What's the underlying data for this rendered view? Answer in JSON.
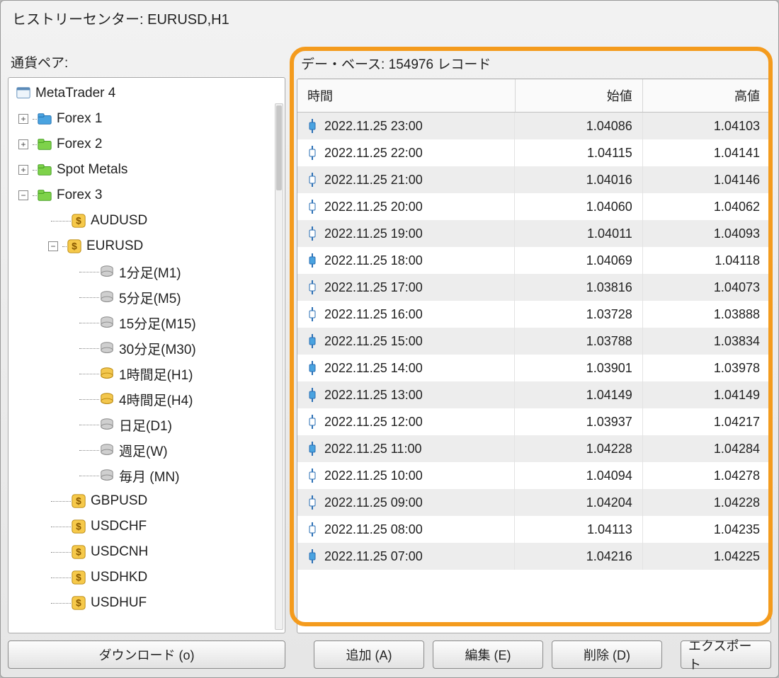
{
  "title": "ヒストリーセンター: EURUSD,H1",
  "left": {
    "label": "通貨ペア:",
    "root": "MetaTrader 4",
    "groups": [
      {
        "name": "Forex 1",
        "color": "blue",
        "expanded": false
      },
      {
        "name": "Forex 2",
        "color": "green",
        "expanded": false
      },
      {
        "name": "Spot Metals",
        "color": "green",
        "expanded": false
      },
      {
        "name": "Forex 3",
        "color": "green",
        "expanded": true
      }
    ],
    "symbols_before": [
      "AUDUSD"
    ],
    "selected_symbol": "EURUSD",
    "timeframes": [
      {
        "label": "1分足(M1)",
        "state": "grey"
      },
      {
        "label": "5分足(M5)",
        "state": "grey"
      },
      {
        "label": "15分足(M15)",
        "state": "grey"
      },
      {
        "label": "30分足(M30)",
        "state": "grey"
      },
      {
        "label": "1時間足(H1)",
        "state": "gold"
      },
      {
        "label": "4時間足(H4)",
        "state": "gold"
      },
      {
        "label": "日足(D1)",
        "state": "grey"
      },
      {
        "label": "週足(W)",
        "state": "grey"
      },
      {
        "label": "毎月 (MN)",
        "state": "grey"
      }
    ],
    "symbols_after": [
      "GBPUSD",
      "USDCHF",
      "USDCNH",
      "USDHKD",
      "USDHUF"
    ]
  },
  "right": {
    "db_prefix": "デー・ベース:",
    "record_count": "154976",
    "db_suffix": "レコード",
    "columns": [
      "時間",
      "始値",
      "高値"
    ],
    "rows": [
      {
        "t": "2022.11.25 23:00",
        "o": "1.04086",
        "h": "1.04103",
        "c": "blue"
      },
      {
        "t": "2022.11.25 22:00",
        "o": "1.04115",
        "h": "1.04141",
        "c": "hollow"
      },
      {
        "t": "2022.11.25 21:00",
        "o": "1.04016",
        "h": "1.04146",
        "c": "hollow"
      },
      {
        "t": "2022.11.25 20:00",
        "o": "1.04060",
        "h": "1.04062",
        "c": "hollow"
      },
      {
        "t": "2022.11.25 19:00",
        "o": "1.04011",
        "h": "1.04093",
        "c": "hollow"
      },
      {
        "t": "2022.11.25 18:00",
        "o": "1.04069",
        "h": "1.04118",
        "c": "blue"
      },
      {
        "t": "2022.11.25 17:00",
        "o": "1.03816",
        "h": "1.04073",
        "c": "hollow"
      },
      {
        "t": "2022.11.25 16:00",
        "o": "1.03728",
        "h": "1.03888",
        "c": "hollow"
      },
      {
        "t": "2022.11.25 15:00",
        "o": "1.03788",
        "h": "1.03834",
        "c": "blue"
      },
      {
        "t": "2022.11.25 14:00",
        "o": "1.03901",
        "h": "1.03978",
        "c": "blue"
      },
      {
        "t": "2022.11.25 13:00",
        "o": "1.04149",
        "h": "1.04149",
        "c": "blue"
      },
      {
        "t": "2022.11.25 12:00",
        "o": "1.03937",
        "h": "1.04217",
        "c": "hollow"
      },
      {
        "t": "2022.11.25 11:00",
        "o": "1.04228",
        "h": "1.04284",
        "c": "blue"
      },
      {
        "t": "2022.11.25 10:00",
        "o": "1.04094",
        "h": "1.04278",
        "c": "hollow"
      },
      {
        "t": "2022.11.25 09:00",
        "o": "1.04204",
        "h": "1.04228",
        "c": "hollow"
      },
      {
        "t": "2022.11.25 08:00",
        "o": "1.04113",
        "h": "1.04235",
        "c": "hollow"
      },
      {
        "t": "2022.11.25 07:00",
        "o": "1.04216",
        "h": "1.04225",
        "c": "blue"
      }
    ]
  },
  "buttons": {
    "download": "ダウンロード (o)",
    "add": "追加 (A)",
    "edit": "編集 (E)",
    "delete": "削除 (D)",
    "export": "エクスポート"
  }
}
